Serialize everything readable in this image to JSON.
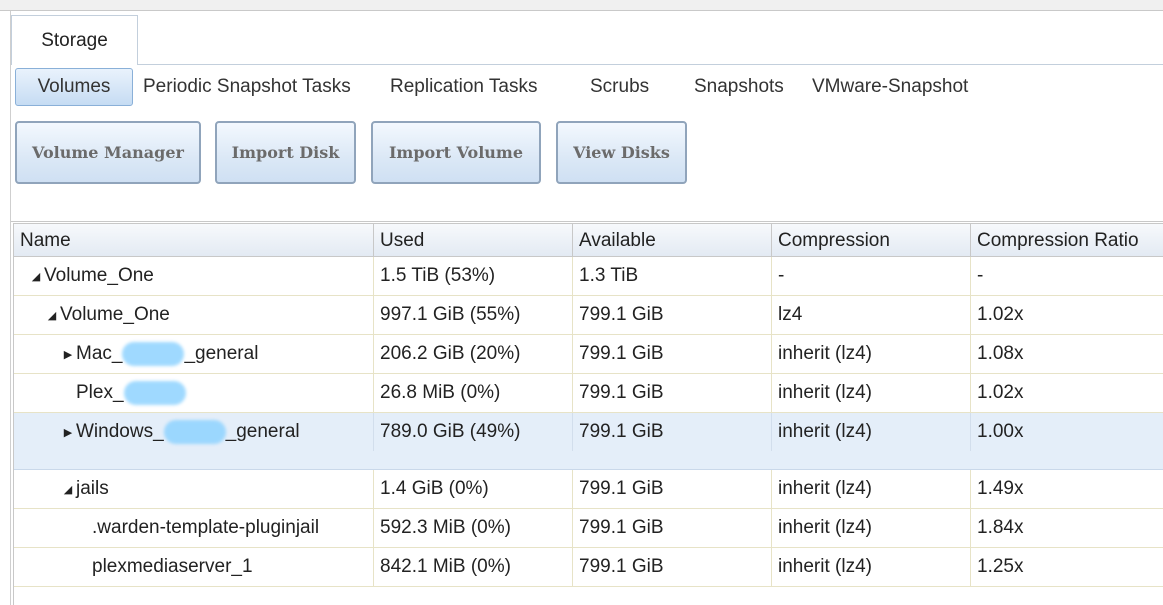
{
  "main_tab": {
    "label": "Storage"
  },
  "sub_tabs": [
    {
      "label": "Volumes",
      "active": true
    },
    {
      "label": "Periodic Snapshot Tasks"
    },
    {
      "label": "Replication Tasks"
    },
    {
      "label": "Scrubs"
    },
    {
      "label": "Snapshots"
    },
    {
      "label": "VMware-Snapshot"
    }
  ],
  "toolbar": {
    "volume_manager": "Volume Manager",
    "import_disk": "Import Disk",
    "import_volume": "Import Volume",
    "view_disks": "View Disks"
  },
  "grid": {
    "columns": [
      "Name",
      "Used",
      "Available",
      "Compression",
      "Compression Ratio"
    ],
    "rows": [
      {
        "prefix": "Volume_One",
        "suffix": "",
        "used": "1.5 TiB (53%)",
        "available": "1.3 TiB",
        "compression": "-",
        "ratio": "-",
        "expander": "expanded"
      },
      {
        "prefix": "Volume_One",
        "suffix": "",
        "used": "997.1 GiB (55%)",
        "available": "799.1 GiB",
        "compression": "lz4",
        "ratio": "1.02x",
        "expander": "expanded"
      },
      {
        "prefix": "Mac_",
        "suffix": "_general",
        "used": "206.2 GiB (20%)",
        "available": "799.1 GiB",
        "compression": "inherit (lz4)",
        "ratio": "1.08x",
        "expander": "collapsed",
        "redacted": true
      },
      {
        "prefix": "Plex_",
        "suffix": "",
        "used": "26.8 MiB (0%)",
        "available": "799.1 GiB",
        "compression": "inherit (lz4)",
        "ratio": "1.02x",
        "expander": "none",
        "redacted": true
      },
      {
        "prefix": "Windows_",
        "suffix": "_general",
        "used": "789.0 GiB (49%)",
        "available": "799.1 GiB",
        "compression": "inherit (lz4)",
        "ratio": "1.00x",
        "expander": "collapsed",
        "redacted": true,
        "selected": true
      },
      {
        "prefix": "jails",
        "suffix": "",
        "used": "1.4 GiB (0%)",
        "available": "799.1 GiB",
        "compression": "inherit (lz4)",
        "ratio": "1.49x",
        "expander": "expanded"
      },
      {
        "prefix": ".warden-template-pluginjail",
        "suffix": "",
        "used": "592.3 MiB (0%)",
        "available": "799.1 GiB",
        "compression": "inherit (lz4)",
        "ratio": "1.84x",
        "expander": "none"
      },
      {
        "prefix": "plexmediaserver_1",
        "suffix": "",
        "used": "842.1 MiB (0%)",
        "available": "799.1 GiB",
        "compression": "inherit (lz4)",
        "ratio": "1.25x",
        "expander": "none"
      }
    ]
  },
  "colors": {
    "accent": "#c6dcf3",
    "selected_row": "#e4eef9",
    "redaction": "#8fd3ff"
  }
}
